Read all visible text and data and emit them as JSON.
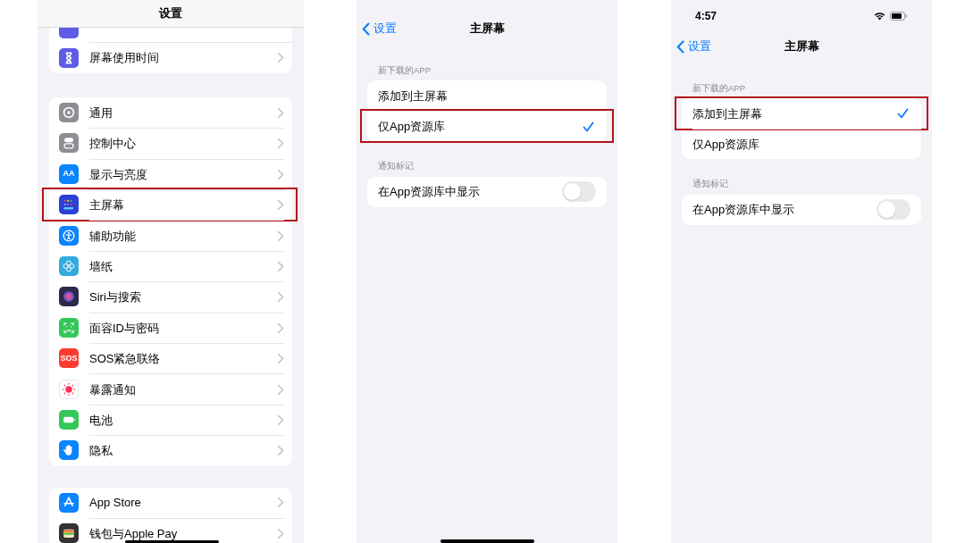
{
  "settings_screen": {
    "title": "设置",
    "groups": [
      {
        "rows": [
          {
            "label": "屏幕使用时间",
            "color": "#5e5ce6",
            "highlighted": false
          }
        ]
      },
      {
        "rows": [
          {
            "label": "通用",
            "color": "#8e8e93",
            "highlighted": false
          },
          {
            "label": "控制中心",
            "color": "#8e8e93",
            "highlighted": false
          },
          {
            "label": "显示与亮度",
            "color": "#0a84ff",
            "icon_text": "AA",
            "highlighted": false
          },
          {
            "label": "主屏幕",
            "color": "#2c3fd6",
            "highlighted": true
          },
          {
            "label": "辅助功能",
            "color": "#0a84ff",
            "highlighted": false
          },
          {
            "label": "墙纸",
            "color": "#34aadc",
            "highlighted": false
          },
          {
            "label": "Siri与搜索",
            "color": "#2a2a4a",
            "highlighted": false
          },
          {
            "label": "面容ID与密码",
            "color": "#34c759",
            "highlighted": false
          },
          {
            "label": "SOS紧急联络",
            "color": "#ff3b30",
            "icon_text": "SOS",
            "highlighted": false
          },
          {
            "label": "暴露通知",
            "color": "#ffffff",
            "highlighted": false
          },
          {
            "label": "电池",
            "color": "#34c759",
            "highlighted": false
          },
          {
            "label": "隐私",
            "color": "#0a84ff",
            "highlighted": false
          }
        ]
      },
      {
        "rows": [
          {
            "label": "App Store",
            "color": "#0a84ff",
            "highlighted": false
          },
          {
            "label": "钱包与Apple Pay",
            "color": "#333333",
            "highlighted": false
          }
        ]
      }
    ]
  },
  "home_screen_pages": [
    {
      "back_label": "设置",
      "title": "主屏幕",
      "sections": [
        {
          "header": "新下载的APP",
          "rows": [
            {
              "kind": "option",
              "label": "添加到主屏幕",
              "selected": false,
              "highlighted": false
            },
            {
              "kind": "option",
              "label": "仅App资源库",
              "selected": true,
              "highlighted": true
            }
          ]
        },
        {
          "header": "通知标记",
          "rows": [
            {
              "kind": "toggle",
              "label": "在App资源库中显示",
              "on": false,
              "highlighted": false
            }
          ]
        }
      ]
    },
    {
      "status_time": "4:57",
      "back_label": "设置",
      "title": "主屏幕",
      "sections": [
        {
          "header": "新下载的APP",
          "rows": [
            {
              "kind": "option",
              "label": "添加到主屏幕",
              "selected": true,
              "highlighted": true
            },
            {
              "kind": "option",
              "label": "仅App资源库",
              "selected": false,
              "highlighted": false
            }
          ]
        },
        {
          "header": "通知标记",
          "rows": [
            {
              "kind": "toggle",
              "label": "在App资源库中显示",
              "on": false,
              "highlighted": false
            }
          ]
        }
      ]
    }
  ]
}
